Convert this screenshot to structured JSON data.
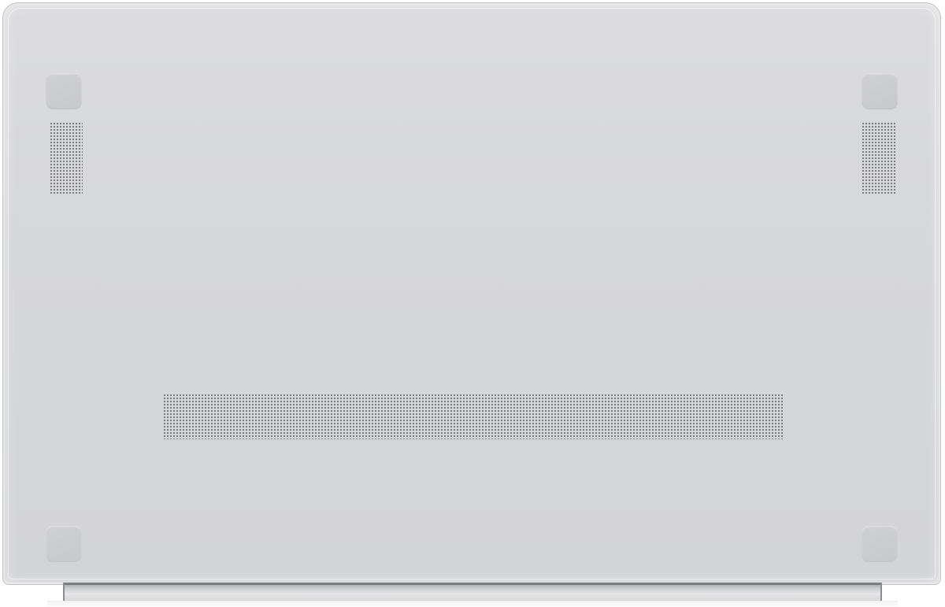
{
  "image": {
    "subject": "laptop-bottom-panel",
    "colors": {
      "body": "#d6d7d9",
      "edge": "#c2c3c5",
      "foot": "#cbccce",
      "grille_hole": "#6f7174",
      "hinge": "#c9cacc"
    },
    "parts": {
      "rubber_feet": 4,
      "speaker_grilles": 2,
      "vent_grilles": 1
    }
  }
}
